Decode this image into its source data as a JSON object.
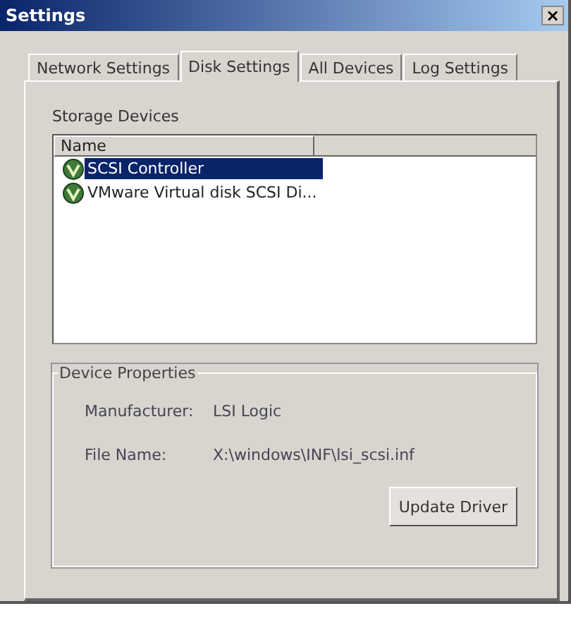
{
  "window": {
    "title": "Settings",
    "close": "×"
  },
  "tabs": [
    {
      "label": "Network Settings",
      "selected": false
    },
    {
      "label": "Disk Settings",
      "selected": true
    },
    {
      "label": "All Devices",
      "selected": false
    },
    {
      "label": "Log Settings",
      "selected": false
    }
  ],
  "storage": {
    "label": "Storage Devices",
    "columns": [
      "Name"
    ],
    "rows": [
      {
        "name": "SCSI Controller",
        "selected": true
      },
      {
        "name": "VMware Virtual disk SCSI Di...",
        "selected": false
      }
    ]
  },
  "properties": {
    "title": "Device Properties",
    "fields": [
      {
        "label": "Manufacturer:",
        "value": "LSI Logic"
      },
      {
        "label": "File Name:",
        "value": "X:\\windows\\INF\\lsi_scsi.inf"
      }
    ],
    "button": "Update Driver"
  }
}
